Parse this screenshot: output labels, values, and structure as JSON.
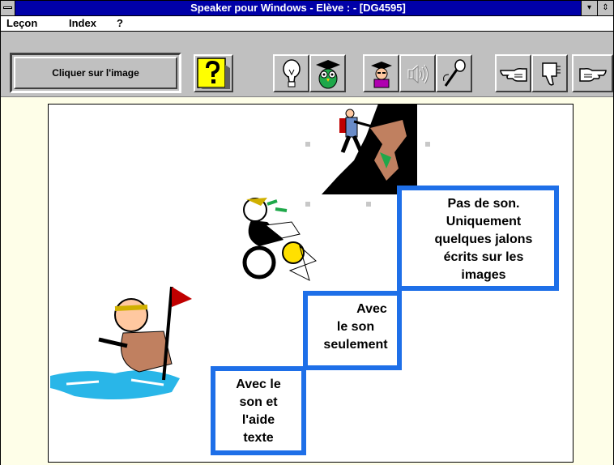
{
  "window": {
    "title": "Speaker pour Windows - Elève : - [DG4595]",
    "min_glyph": "▾",
    "max_glyph": "⇕"
  },
  "menu": [
    "Leçon",
    "Index",
    "?"
  ],
  "toolbar": {
    "status_text": "Cliquer sur l'image",
    "buttons": [
      {
        "name": "help-button",
        "icon": "question-mark-icon"
      },
      {
        "name": "hint-button",
        "icon": "lightbulb-icon"
      },
      {
        "name": "owl-teacher-button",
        "icon": "owl-graduate-icon"
      },
      {
        "name": "student-button",
        "icon": "student-icon"
      },
      {
        "name": "speaker-button",
        "icon": "speaker-icon",
        "disabled": true
      },
      {
        "name": "microphone-button",
        "icon": "microphone-icon"
      },
      {
        "name": "point-left-button",
        "icon": "hand-point-icon"
      },
      {
        "name": "thumbs-down-button",
        "icon": "thumbs-down-icon"
      },
      {
        "name": "point-right-button",
        "icon": "hand-point-right-icon"
      }
    ]
  },
  "steps": {
    "step1": {
      "lines": [
        "Avec le",
        "son et",
        "l'aide",
        "texte"
      ]
    },
    "step2": {
      "lines": [
        "Avec",
        "le son",
        "seulement"
      ]
    },
    "step3": {
      "lines": [
        "Pas de son.",
        "Uniquement",
        "quelques jalons",
        "écrits sur les",
        "images"
      ]
    }
  },
  "colors": {
    "box_border": "#1e6fe8",
    "title_bar": "#0000a8",
    "water": "#29b6e8"
  }
}
